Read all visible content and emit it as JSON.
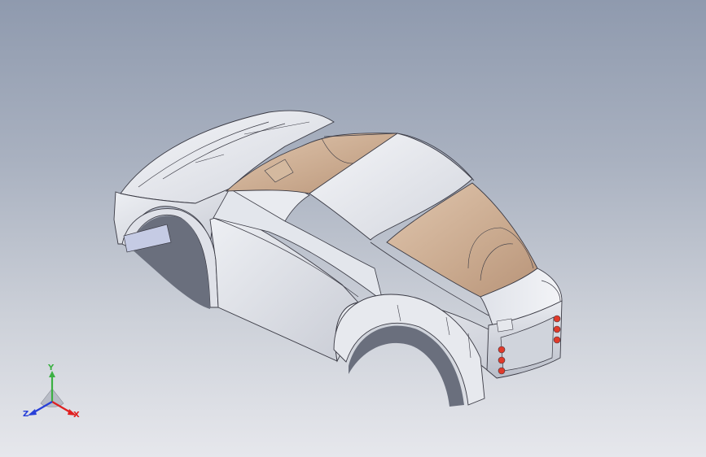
{
  "app": {
    "view": "isometric",
    "background_top": "#8f9aae",
    "background_bottom": "#e6e7ec"
  },
  "model": {
    "body_color": "#e4e6ec",
    "glass_color": "#c9a98e",
    "tail_light_color": "#e03a2a"
  },
  "triad": {
    "x_label": "X",
    "y_label": "Y",
    "z_label": "Z",
    "x_color": "#e02020",
    "y_color": "#3cb043",
    "z_color": "#2840d8"
  }
}
